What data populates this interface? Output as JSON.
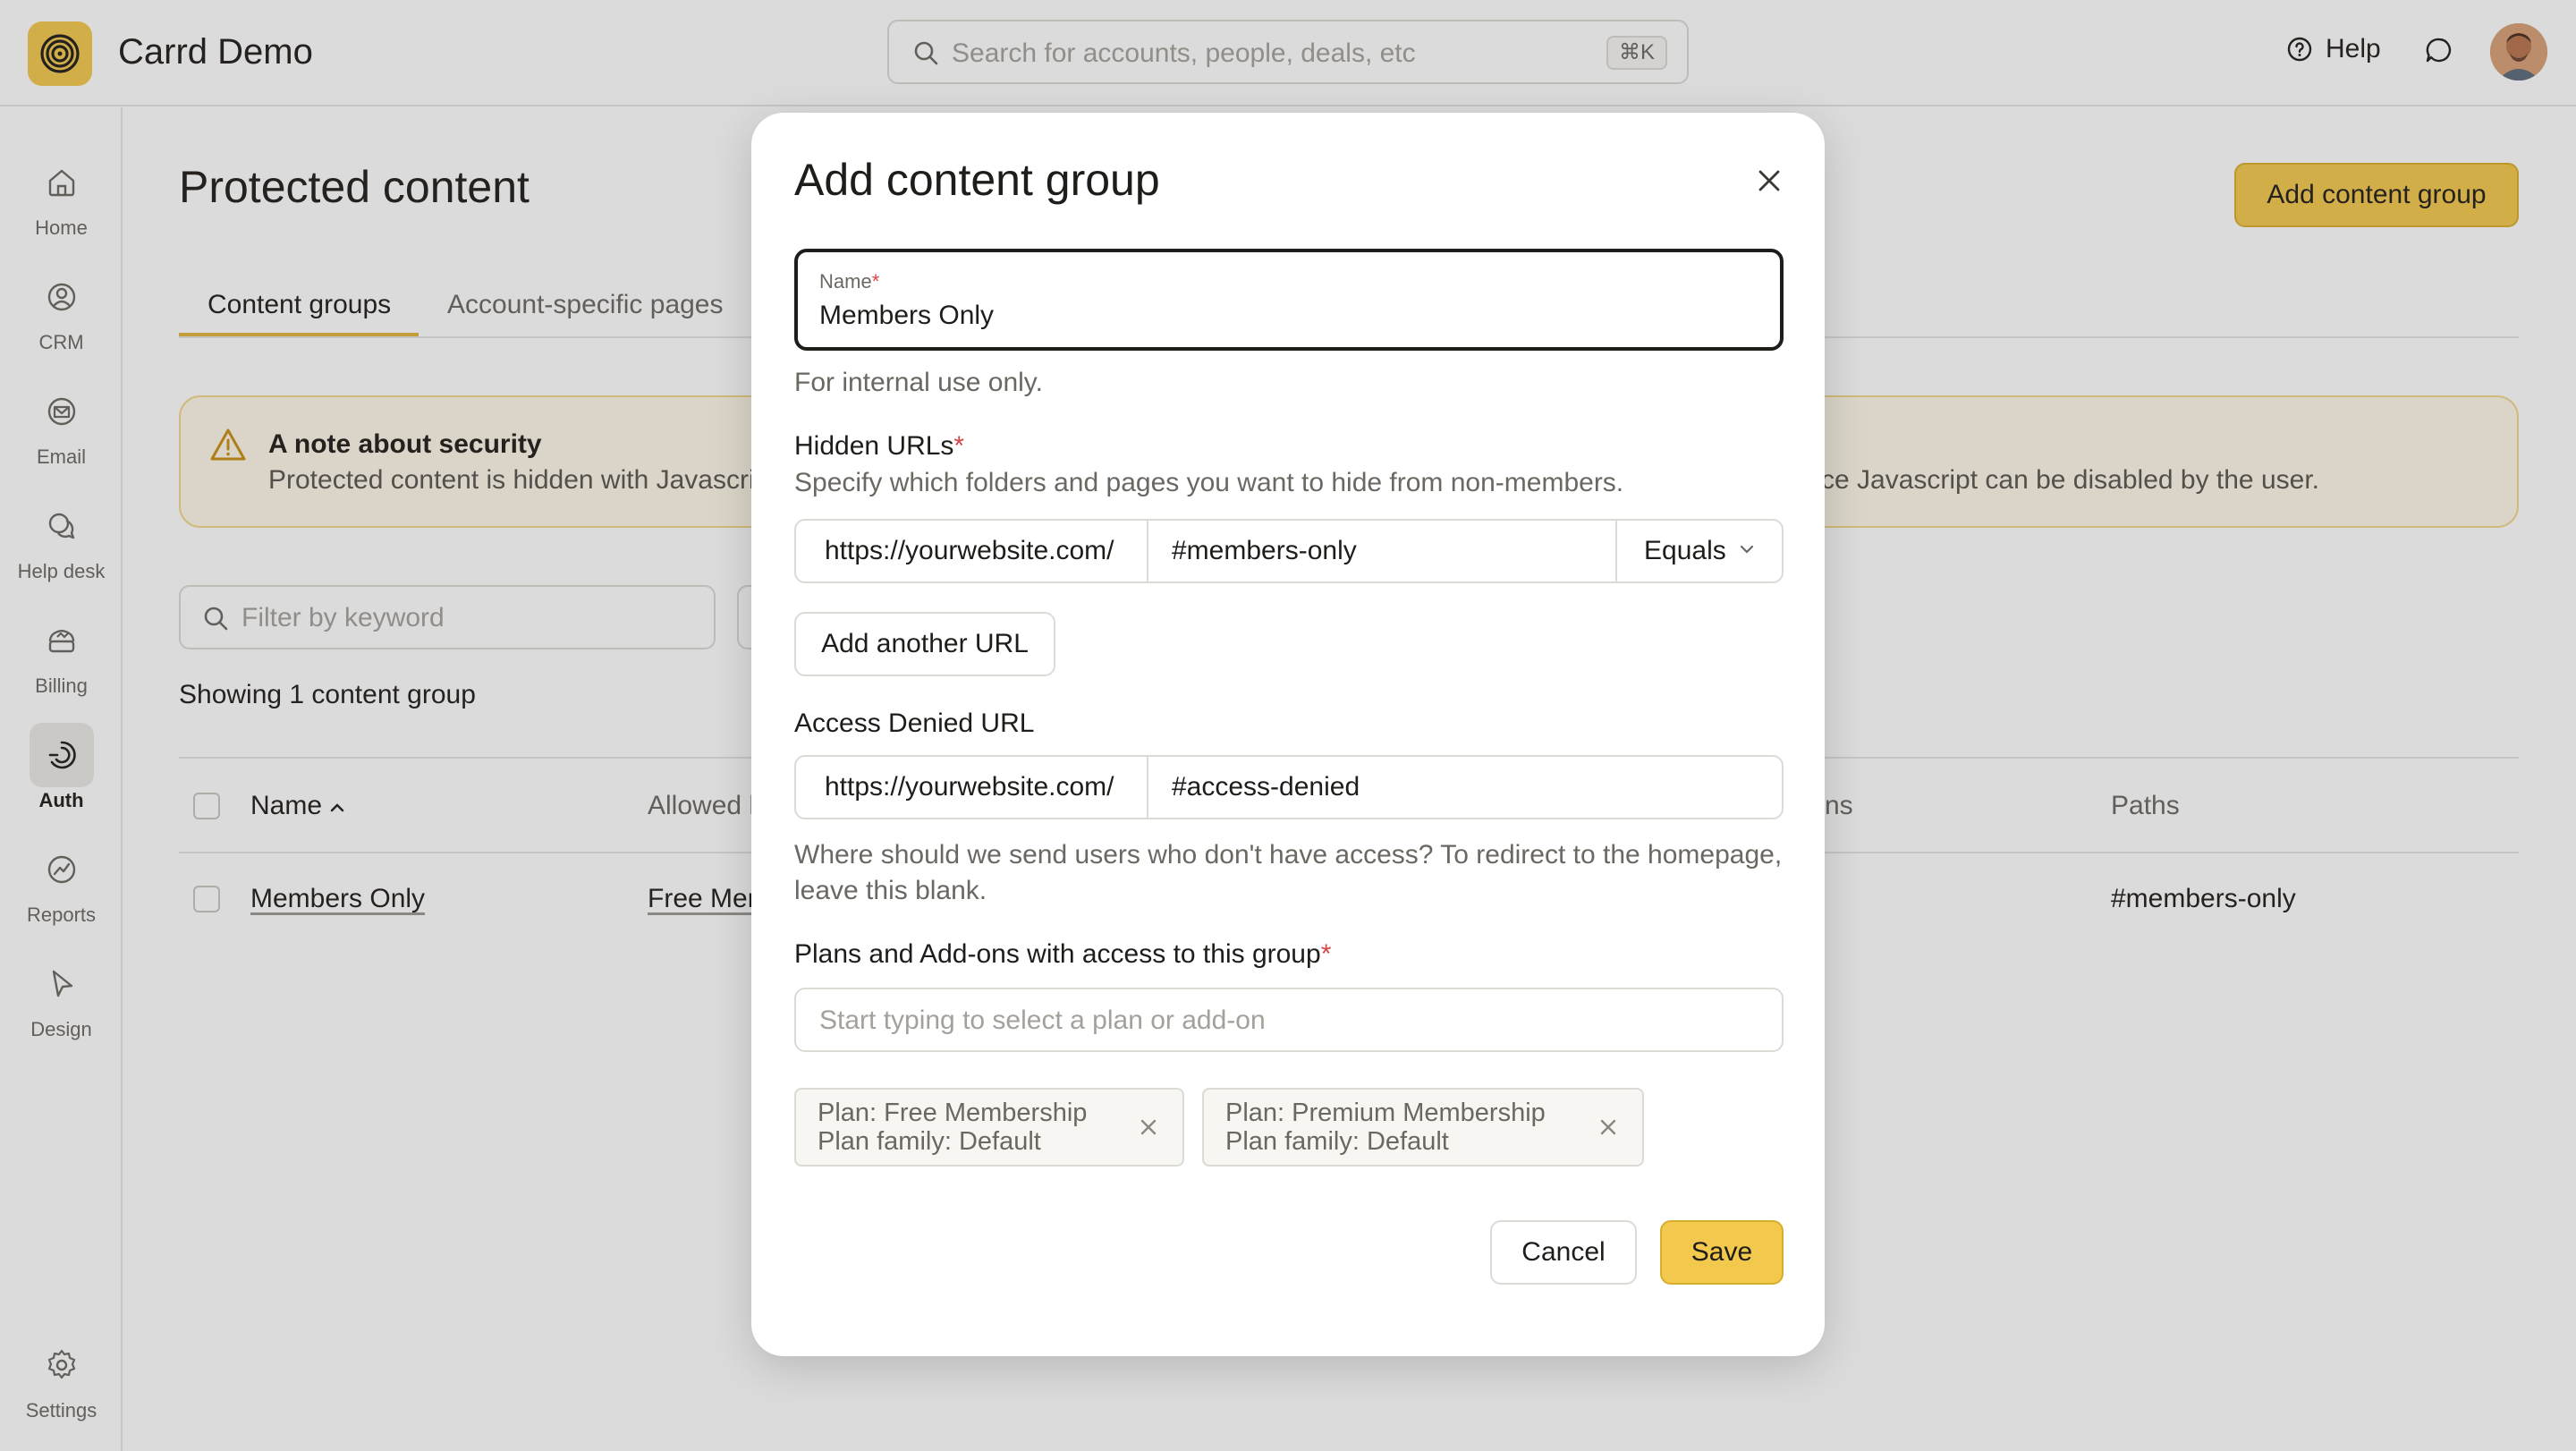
{
  "header": {
    "app_title": "Carrd Demo",
    "search_placeholder": "Search for accounts, people, deals, etc",
    "search_shortcut": "⌘K",
    "help_label": "Help",
    "icons": {
      "logo": "spiral-logo-icon",
      "search": "search-icon",
      "help": "question-circle-icon",
      "chat": "chat-bubble-icon",
      "avatar": "user-avatar"
    },
    "brand_color": "#f2c94c"
  },
  "sidebar": {
    "items": [
      {
        "label": "Home",
        "icon": "home-icon",
        "active": false
      },
      {
        "label": "CRM",
        "icon": "person-circle-icon",
        "active": false
      },
      {
        "label": "Email",
        "icon": "envelope-icon",
        "active": false
      },
      {
        "label": "Help desk",
        "icon": "chat-bubbles-icon",
        "active": false
      },
      {
        "label": "Billing",
        "icon": "billing-icon",
        "active": false
      },
      {
        "label": "Auth",
        "icon": "auth-icon",
        "active": true
      },
      {
        "label": "Reports",
        "icon": "chart-icon",
        "active": false
      },
      {
        "label": "Design",
        "icon": "cursor-icon",
        "active": false
      }
    ],
    "settings_label": "Settings"
  },
  "main": {
    "page_title": "Protected content",
    "add_button_label": "Add content group",
    "tabs": [
      {
        "label": "Content groups",
        "active": true
      },
      {
        "label": "Account-specific pages",
        "active": false
      }
    ],
    "notice": {
      "title": "A note about security",
      "body_visible_start": "Protected content is hidden with Javascrip",
      "body_visible_end": "ce Javascript can be disabled by the user."
    },
    "filter_placeholder": "Filter by keyword",
    "showing_text": "Showing 1 content group",
    "table": {
      "headers": {
        "name": "Name",
        "allowed": "Allowed l",
        "plans": "ns",
        "paths": "Paths"
      },
      "rows": [
        {
          "name": "Members Only",
          "allowed": "Free Mer",
          "paths": "#members-only"
        }
      ]
    }
  },
  "modal": {
    "title": "Add content group",
    "name_field": {
      "label": "Name",
      "required_mark": "*",
      "value": "Members Only"
    },
    "name_hint": "For internal use only.",
    "hidden_urls": {
      "label": "Hidden URLs",
      "required_mark": "*",
      "description": "Specify which folders and pages you want to hide from non-members.",
      "prefix": "https://yourwebsite.com/",
      "path": "#members-only",
      "match": "Equals"
    },
    "add_url_label": "Add another URL",
    "access_denied": {
      "label": "Access Denied URL",
      "prefix": "https://yourwebsite.com/",
      "path": "#access-denied",
      "hint_line1": "Where should we send users who don't have access? To redirect to the homepage,",
      "hint_line2": "leave this blank."
    },
    "plans": {
      "label": "Plans and Add-ons with access to this group",
      "required_mark": "*",
      "placeholder": "Start typing to select a plan or add-on",
      "chips": [
        {
          "line1": "Plan: Free Membership",
          "line2": "Plan family: Default"
        },
        {
          "line1": "Plan: Premium Membership",
          "line2": "Plan family: Default"
        }
      ]
    },
    "cancel_label": "Cancel",
    "save_label": "Save"
  }
}
